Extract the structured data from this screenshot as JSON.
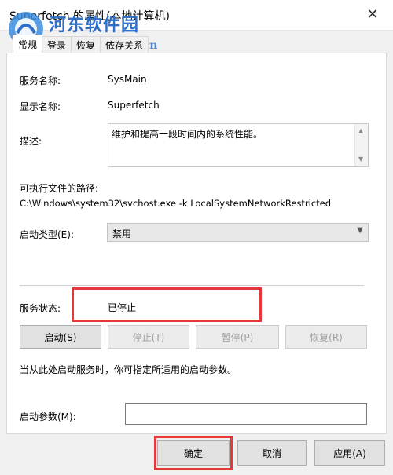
{
  "window": {
    "title": "Superfetch 的属性(本地计算机)",
    "close_glyph": "✕"
  },
  "watermark": {
    "name": "河东软件园",
    "url": "www.pc0359.cn"
  },
  "tabs": [
    {
      "label": "常规",
      "active": true
    },
    {
      "label": "登录",
      "active": false
    },
    {
      "label": "恢复",
      "active": false
    },
    {
      "label": "依存关系",
      "active": false
    }
  ],
  "general": {
    "service_name_label": "服务名称:",
    "service_name_value": "SysMain",
    "display_name_label": "显示名称:",
    "display_name_value": "Superfetch",
    "description_label": "描述:",
    "description_value": "维护和提高一段时间内的系统性能。",
    "path_label": "可执行文件的路径:",
    "path_value": "C:\\Windows\\system32\\svchost.exe -k LocalSystemNetworkRestricted",
    "startup_type_label": "启动类型(E):",
    "startup_type_value": "禁用",
    "status_label": "服务状态:",
    "status_value": "已停止",
    "hint": "当从此处启动服务时，你可指定所适用的启动参数。",
    "params_label": "启动参数(M):",
    "params_value": ""
  },
  "service_buttons": {
    "start": "启动(S)",
    "stop": "停止(T)",
    "pause": "暂停(P)",
    "resume": "恢复(R)"
  },
  "dialog_buttons": {
    "ok": "确定",
    "cancel": "取消",
    "apply": "应用(A)"
  },
  "colors": {
    "highlight": "#e5383b",
    "watermark": "#2d6fc9"
  }
}
